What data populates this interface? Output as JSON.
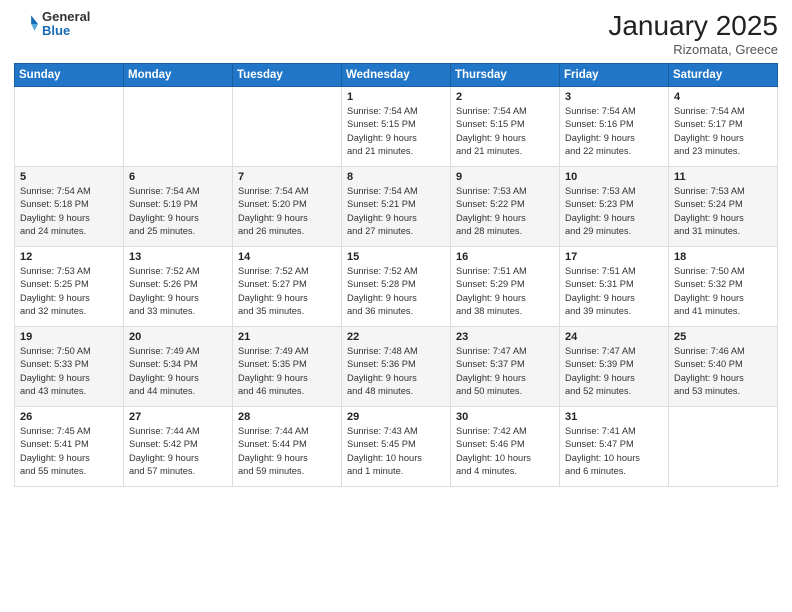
{
  "header": {
    "logo_general": "General",
    "logo_blue": "Blue",
    "month_title": "January 2025",
    "location": "Rizomata, Greece"
  },
  "days_of_week": [
    "Sunday",
    "Monday",
    "Tuesday",
    "Wednesday",
    "Thursday",
    "Friday",
    "Saturday"
  ],
  "weeks": [
    [
      {
        "day": "",
        "info": ""
      },
      {
        "day": "",
        "info": ""
      },
      {
        "day": "",
        "info": ""
      },
      {
        "day": "1",
        "info": "Sunrise: 7:54 AM\nSunset: 5:15 PM\nDaylight: 9 hours\nand 21 minutes."
      },
      {
        "day": "2",
        "info": "Sunrise: 7:54 AM\nSunset: 5:15 PM\nDaylight: 9 hours\nand 21 minutes."
      },
      {
        "day": "3",
        "info": "Sunrise: 7:54 AM\nSunset: 5:16 PM\nDaylight: 9 hours\nand 22 minutes."
      },
      {
        "day": "4",
        "info": "Sunrise: 7:54 AM\nSunset: 5:17 PM\nDaylight: 9 hours\nand 23 minutes."
      }
    ],
    [
      {
        "day": "5",
        "info": "Sunrise: 7:54 AM\nSunset: 5:18 PM\nDaylight: 9 hours\nand 24 minutes."
      },
      {
        "day": "6",
        "info": "Sunrise: 7:54 AM\nSunset: 5:19 PM\nDaylight: 9 hours\nand 25 minutes."
      },
      {
        "day": "7",
        "info": "Sunrise: 7:54 AM\nSunset: 5:20 PM\nDaylight: 9 hours\nand 26 minutes."
      },
      {
        "day": "8",
        "info": "Sunrise: 7:54 AM\nSunset: 5:21 PM\nDaylight: 9 hours\nand 27 minutes."
      },
      {
        "day": "9",
        "info": "Sunrise: 7:53 AM\nSunset: 5:22 PM\nDaylight: 9 hours\nand 28 minutes."
      },
      {
        "day": "10",
        "info": "Sunrise: 7:53 AM\nSunset: 5:23 PM\nDaylight: 9 hours\nand 29 minutes."
      },
      {
        "day": "11",
        "info": "Sunrise: 7:53 AM\nSunset: 5:24 PM\nDaylight: 9 hours\nand 31 minutes."
      }
    ],
    [
      {
        "day": "12",
        "info": "Sunrise: 7:53 AM\nSunset: 5:25 PM\nDaylight: 9 hours\nand 32 minutes."
      },
      {
        "day": "13",
        "info": "Sunrise: 7:52 AM\nSunset: 5:26 PM\nDaylight: 9 hours\nand 33 minutes."
      },
      {
        "day": "14",
        "info": "Sunrise: 7:52 AM\nSunset: 5:27 PM\nDaylight: 9 hours\nand 35 minutes."
      },
      {
        "day": "15",
        "info": "Sunrise: 7:52 AM\nSunset: 5:28 PM\nDaylight: 9 hours\nand 36 minutes."
      },
      {
        "day": "16",
        "info": "Sunrise: 7:51 AM\nSunset: 5:29 PM\nDaylight: 9 hours\nand 38 minutes."
      },
      {
        "day": "17",
        "info": "Sunrise: 7:51 AM\nSunset: 5:31 PM\nDaylight: 9 hours\nand 39 minutes."
      },
      {
        "day": "18",
        "info": "Sunrise: 7:50 AM\nSunset: 5:32 PM\nDaylight: 9 hours\nand 41 minutes."
      }
    ],
    [
      {
        "day": "19",
        "info": "Sunrise: 7:50 AM\nSunset: 5:33 PM\nDaylight: 9 hours\nand 43 minutes."
      },
      {
        "day": "20",
        "info": "Sunrise: 7:49 AM\nSunset: 5:34 PM\nDaylight: 9 hours\nand 44 minutes."
      },
      {
        "day": "21",
        "info": "Sunrise: 7:49 AM\nSunset: 5:35 PM\nDaylight: 9 hours\nand 46 minutes."
      },
      {
        "day": "22",
        "info": "Sunrise: 7:48 AM\nSunset: 5:36 PM\nDaylight: 9 hours\nand 48 minutes."
      },
      {
        "day": "23",
        "info": "Sunrise: 7:47 AM\nSunset: 5:37 PM\nDaylight: 9 hours\nand 50 minutes."
      },
      {
        "day": "24",
        "info": "Sunrise: 7:47 AM\nSunset: 5:39 PM\nDaylight: 9 hours\nand 52 minutes."
      },
      {
        "day": "25",
        "info": "Sunrise: 7:46 AM\nSunset: 5:40 PM\nDaylight: 9 hours\nand 53 minutes."
      }
    ],
    [
      {
        "day": "26",
        "info": "Sunrise: 7:45 AM\nSunset: 5:41 PM\nDaylight: 9 hours\nand 55 minutes."
      },
      {
        "day": "27",
        "info": "Sunrise: 7:44 AM\nSunset: 5:42 PM\nDaylight: 9 hours\nand 57 minutes."
      },
      {
        "day": "28",
        "info": "Sunrise: 7:44 AM\nSunset: 5:44 PM\nDaylight: 9 hours\nand 59 minutes."
      },
      {
        "day": "29",
        "info": "Sunrise: 7:43 AM\nSunset: 5:45 PM\nDaylight: 10 hours\nand 1 minute."
      },
      {
        "day": "30",
        "info": "Sunrise: 7:42 AM\nSunset: 5:46 PM\nDaylight: 10 hours\nand 4 minutes."
      },
      {
        "day": "31",
        "info": "Sunrise: 7:41 AM\nSunset: 5:47 PM\nDaylight: 10 hours\nand 6 minutes."
      },
      {
        "day": "",
        "info": ""
      }
    ]
  ]
}
